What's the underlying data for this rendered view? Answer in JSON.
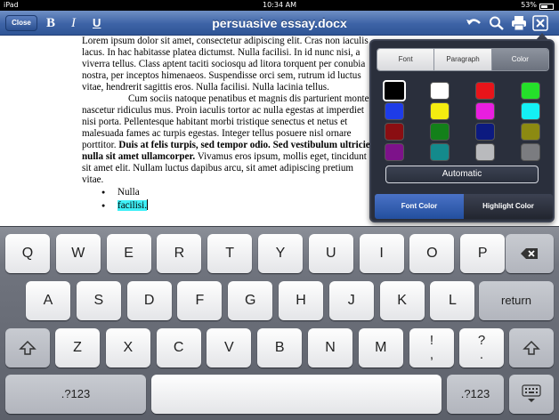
{
  "status_bar": {
    "device": "iPad",
    "time": "10:34 AM",
    "battery": "53%"
  },
  "toolbar": {
    "close_label": "Close",
    "bold_label": "B",
    "italic_label": "I",
    "underline_label": "U",
    "document_title": "persuasive essay.docx",
    "icons": [
      "undo-icon",
      "search-icon",
      "print-icon",
      "close-x-icon"
    ]
  },
  "document": {
    "para1": "Lorem ipsum dolor sit amet, consectetur adipiscing elit. Cras non iaculis lacus. In hac habitasse platea dictumst. Nulla facilisi. In id nunc nisi, a viverra tellus. Class aptent taciti sociosqu ad litora torquent per conubia nostra, per inceptos himenaeos. Suspendisse orci sem, rutrum id luctus vitae, hendrerit sagittis eros. Nulla facilisi. Nulla lacinia tellus.",
    "para2_a": "Cum sociis natoque penatibus et magnis dis parturient montes, nascetur ridiculus mus. Proin iaculis tortor ac nulla egestas at imperdiet nisi porta. Pellentesque habitant morbi tristique senectus et netus et malesuada fames ac turpis egestas. Integer tellus posuere nisl ornare porttitor.",
    "para2_bold": "Duis at felis turpis, sed tempor odio. Sed vestibulum ultricies nulla sit amet ullamcorper.",
    "para2_b": "Vivamus eros ipsum, mollis eget, tincidunt sit amet elit. Nullam luctus dapibus arcu, sit amet adipiscing pretium vitae.",
    "bullets": [
      "Nulla",
      "facilisi."
    ]
  },
  "color_popover": {
    "tabs": [
      "Font",
      "Paragraph",
      "Color"
    ],
    "active_tab": "Color",
    "swatches": [
      [
        "#000000",
        "#ffffff",
        "#e8141a",
        "#25e02a"
      ],
      [
        "#1e3ce8",
        "#f4ec10",
        "#e91ee0",
        "#14f0f4"
      ],
      [
        "#8a0e12",
        "#13801a",
        "#0c1a80",
        "#8c8a12"
      ],
      [
        "#7d128a",
        "#148a8c",
        "#b9babd",
        "#7b7c80"
      ]
    ],
    "selected_color": "#000000",
    "automatic_label": "Automatic",
    "modes": [
      "Font Color",
      "Highlight Color"
    ],
    "active_mode": "Font Color"
  },
  "keyboard": {
    "row1": [
      "Q",
      "W",
      "E",
      "R",
      "T",
      "Y",
      "U",
      "I",
      "O",
      "P"
    ],
    "row2": [
      "A",
      "S",
      "D",
      "F",
      "G",
      "H",
      "J",
      "K",
      "L"
    ],
    "row3": [
      "Z",
      "X",
      "C",
      "V",
      "B",
      "N",
      "M"
    ],
    "punct1_top": "!",
    "punct1_bottom": ",",
    "punct2_top": "?",
    "punct2_bottom": ".",
    "return_label": "return",
    "numbers_label": ".?123"
  }
}
